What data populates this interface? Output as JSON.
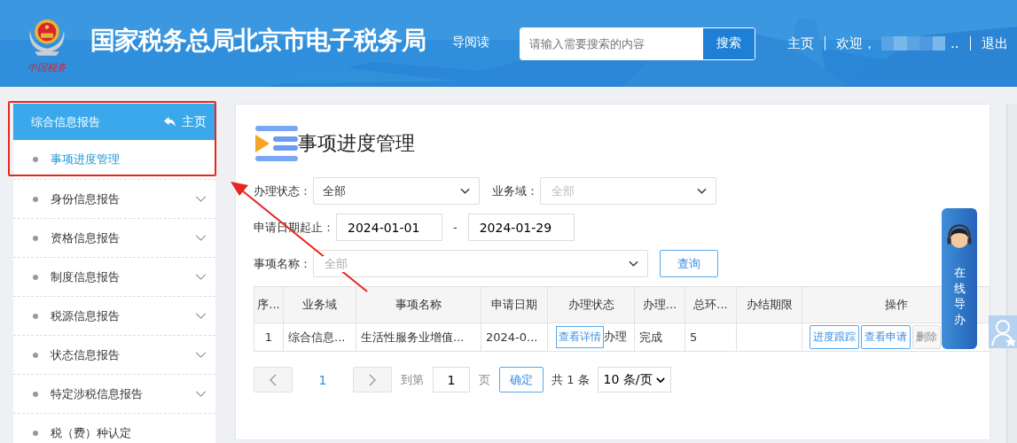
{
  "header": {
    "logo_text": "中国税务",
    "title": "国家税务总局北京市电子税务局",
    "hidden_link": "导阅读",
    "search": {
      "placeholder": "请输入需要搜索的内容",
      "button": "搜索"
    },
    "nav": {
      "home": "主页",
      "welcome": "欢迎，",
      "name_tail": "..",
      "logout": "退出"
    }
  },
  "sidebar": {
    "group": {
      "title": "综合信息报告",
      "home_link": "主页",
      "children": [
        {
          "label": "事项进度管理",
          "selected": true
        }
      ]
    },
    "items": [
      {
        "label": "身份信息报告",
        "kind": "group"
      },
      {
        "label": "资格信息报告",
        "kind": "group"
      },
      {
        "label": "制度信息报告",
        "kind": "group"
      },
      {
        "label": "税源信息报告",
        "kind": "group"
      },
      {
        "label": "状态信息报告",
        "kind": "group"
      },
      {
        "label": "特定涉税信息报告",
        "kind": "group"
      },
      {
        "label": "税（费）种认定",
        "kind": "leaf"
      }
    ]
  },
  "page": {
    "title": "事项进度管理",
    "filters": {
      "status": {
        "label": "办理状态：",
        "value": "全部"
      },
      "domain": {
        "label": "业务域：",
        "placeholder": "全部",
        "disabled": true
      },
      "dates": {
        "label": "申请日期起止：",
        "from": "2024-01-01",
        "separator": "-",
        "to": "2024-01-29"
      },
      "name": {
        "label": "事项名称：",
        "placeholder": "全部"
      },
      "query_button": "查询"
    },
    "table": {
      "columns": [
        "序...",
        "业务域",
        "事项名称",
        "申请日期",
        "办理状态",
        "办理...",
        "总环...",
        "办结期限",
        "操作"
      ],
      "rows": [
        {
          "index": "1",
          "domain": "综合信息...",
          "item": "生活性服务业增值...",
          "date": "2024-0...",
          "status_button": "查看详情",
          "status_text": "办理",
          "result": "完成",
          "steps": "5",
          "actions": [
            {
              "label": "进度跟踪",
              "disabled": false
            },
            {
              "label": "查看申请",
              "disabled": false
            },
            {
              "label": "删除",
              "disabled": true
            }
          ]
        }
      ]
    },
    "pagination": {
      "page": "1",
      "goto_label": "到第",
      "page_input": "1",
      "page_unit": "页",
      "confirm": "确定",
      "total": "共 1 条",
      "page_size": "10 条/页"
    }
  },
  "widget": {
    "label": "在线导办"
  }
}
